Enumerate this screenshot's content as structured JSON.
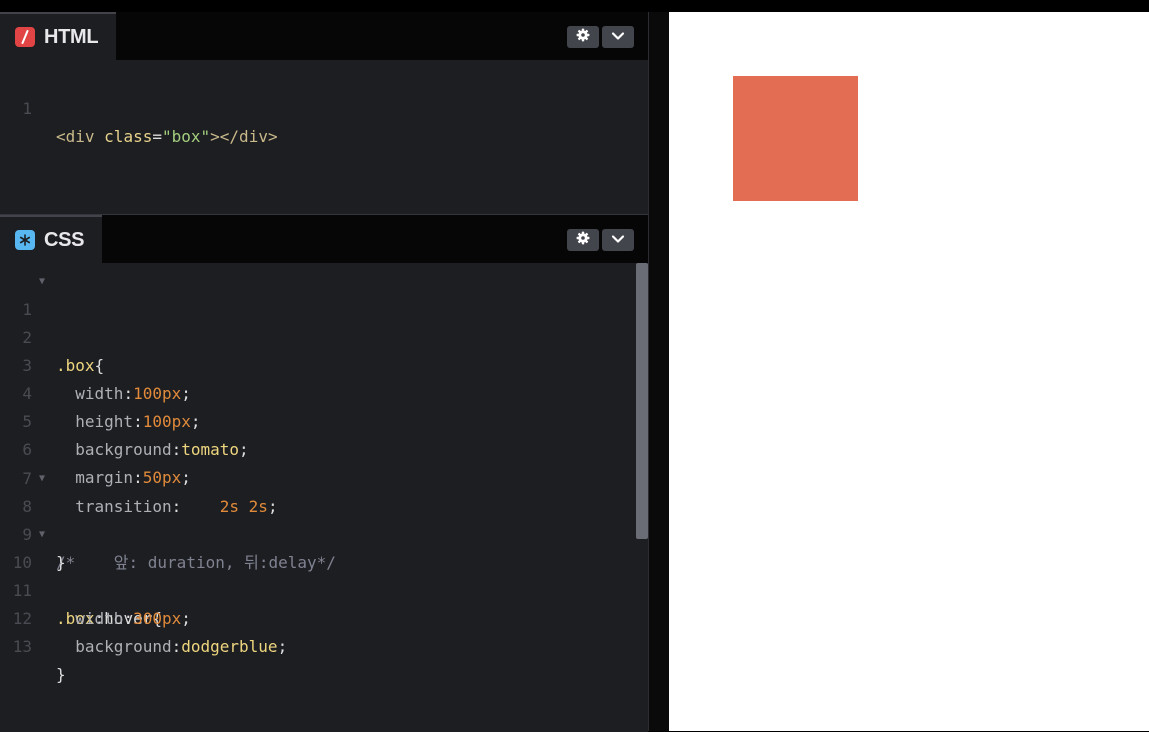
{
  "html_pane": {
    "tab_label": "HTML",
    "lines": [
      {
        "num": "1",
        "tag_open": "<div ",
        "attr": "class",
        "eq": "=",
        "str": "\"box\"",
        "tag_close": "></div>"
      }
    ]
  },
  "css_pane": {
    "tab_label": "CSS",
    "lines": [
      {
        "num": "1",
        "sel": ".box",
        "punc": "{"
      },
      {
        "num": "2"
      },
      {
        "num": "3",
        "prop": "width",
        "val": "100px",
        "end": ";"
      },
      {
        "num": "4",
        "prop": "height",
        "val": "100px",
        "end": ";"
      },
      {
        "num": "5",
        "prop": "background",
        "val": "tomato",
        "end": ";"
      },
      {
        "num": "6",
        "prop": "margin",
        "val": "50px",
        "end": ";"
      },
      {
        "num": "7",
        "prop": "transition",
        "val": "2s 2s",
        "end": ";"
      },
      {
        "num": "8",
        "comment": "/*    앞: duration, 뒤:delay*/"
      },
      {
        "num": "9",
        "punc": "}"
      },
      {
        "num": "10",
        "sel": ".box",
        "pseudo": "hover",
        "punc": "{"
      },
      {
        "num": "11",
        "prop": "width",
        "val": "300px",
        "end": ";"
      },
      {
        "num": "12",
        "prop": "background",
        "val": "dodgerblue",
        "end": ";"
      },
      {
        "num": "13",
        "punc": "}"
      }
    ]
  },
  "icons": {
    "html_tab": "slash-icon",
    "css_tab": "asterisk-icon",
    "settings": "gear-icon",
    "collapse": "chevron-down-icon"
  },
  "colors": {
    "box": "#e36d52",
    "editor_bg": "#1d1e22",
    "html_icon": "#e04444",
    "css_icon": "#58b6f0"
  }
}
